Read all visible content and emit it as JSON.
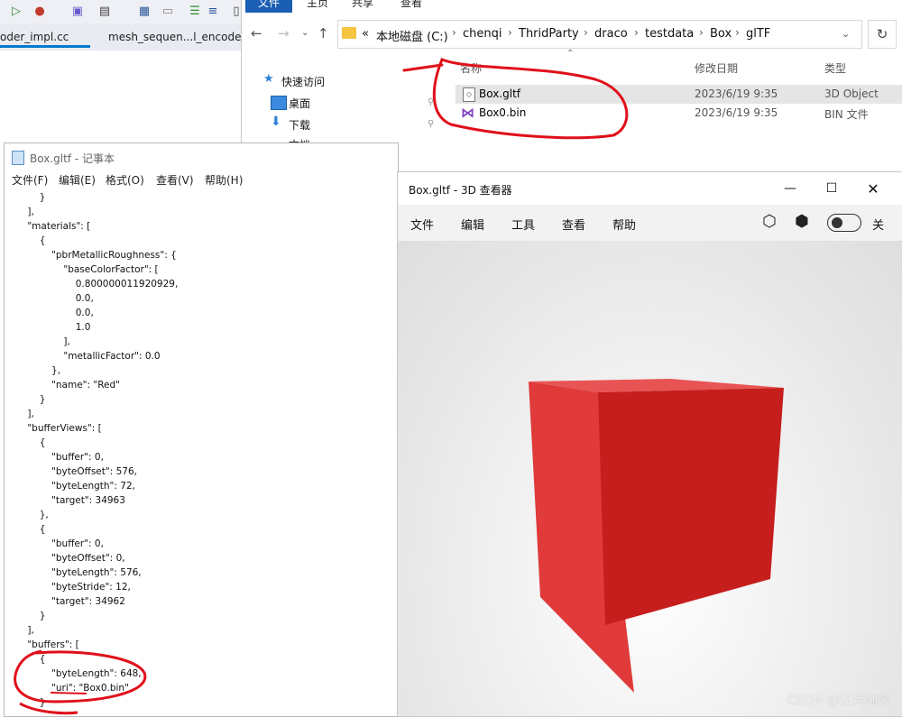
{
  "ide": {
    "tabs": [
      "oder_impl.cc",
      "mesh_sequen...l_encoder.cc"
    ]
  },
  "explorer": {
    "ribbon": {
      "file": "文件",
      "home": "主页",
      "share": "共享",
      "view": "查看"
    },
    "breadcrumb": {
      "prefix": "«",
      "items": [
        "本地磁盘 (C:)",
        "chenqi",
        "ThridParty",
        "draco",
        "testdata",
        "Box",
        "glTF"
      ]
    },
    "sidebar": [
      {
        "label": "快速访问"
      },
      {
        "label": "桌面"
      },
      {
        "label": "下载"
      },
      {
        "label": "文档"
      }
    ],
    "columns": {
      "name": "名称",
      "date": "修改日期",
      "type": "类型"
    },
    "files": [
      {
        "name": "Box.gltf",
        "date": "2023/6/19 9:35",
        "type": "3D Object"
      },
      {
        "name": "Box0.bin",
        "date": "2023/6/19 9:35",
        "type": "BIN 文件"
      }
    ]
  },
  "notepad": {
    "title": "Box.gltf - 记事本",
    "menu": [
      "文件(F)",
      "编辑(E)",
      "格式(O)",
      "查看(V)",
      "帮助(H)"
    ],
    "lines": [
      "        }",
      "    ],",
      "    \"materials\": [",
      "        {",
      "            \"pbrMetallicRoughness\": {",
      "                \"baseColorFactor\": [",
      "                    0.800000011920929,",
      "                    0.0,",
      "                    0.0,",
      "                    1.0",
      "                ],",
      "                \"metallicFactor\": 0.0",
      "            },",
      "            \"name\": \"Red\"",
      "        }",
      "    ],",
      "    \"bufferViews\": [",
      "        {",
      "            \"buffer\": 0,",
      "            \"byteOffset\": 576,",
      "            \"byteLength\": 72,",
      "            \"target\": 34963",
      "        },",
      "        {",
      "            \"buffer\": 0,",
      "            \"byteOffset\": 0,",
      "            \"byteLength\": 576,",
      "            \"byteStride\": 12,",
      "            \"target\": 34962",
      "        }",
      "    ],",
      "    \"buffers\": [",
      "        {",
      "            \"byteLength\": 648,",
      "            \"uri\": \"Box0.bin\"",
      "        }"
    ]
  },
  "viewer": {
    "title": "Box.gltf - 3D 查看器",
    "menu": [
      "文件",
      "编辑",
      "工具",
      "查看",
      "帮助"
    ],
    "toggle_label": "关"
  },
  "watermark": "CSDN @江河地笑",
  "colors": {
    "annotation": "#e0101a",
    "cube_front": "#c81e1e",
    "cube_top": "#e03a3a",
    "accent": "#1a5fb4"
  }
}
